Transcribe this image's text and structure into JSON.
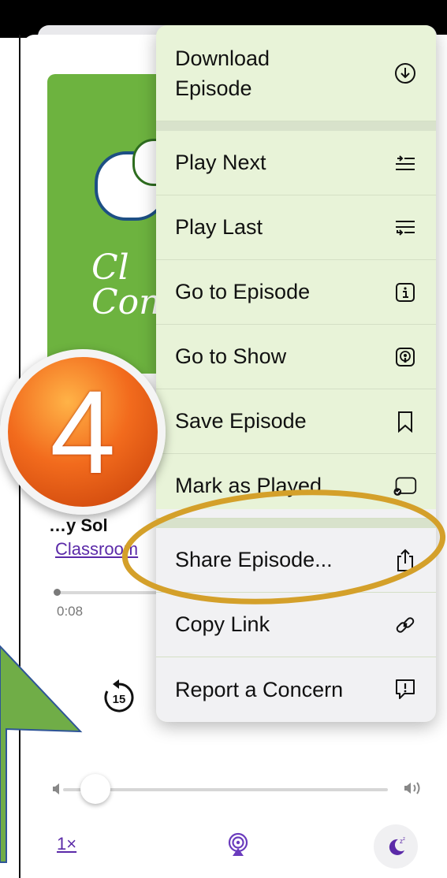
{
  "menu": {
    "items": [
      {
        "label": "Download\nEpisode",
        "icon": "download-circle-icon"
      },
      {
        "label": "Play Next",
        "icon": "play-next-icon"
      },
      {
        "label": "Play Last",
        "icon": "play-last-icon"
      },
      {
        "label": "Go to Episode",
        "icon": "info-icon"
      },
      {
        "label": "Go to Show",
        "icon": "podcast-icon"
      },
      {
        "label": "Save Episode",
        "icon": "bookmark-icon"
      },
      {
        "label": "Mark as Played",
        "icon": "mark-played-icon"
      },
      {
        "label": "Share Episode...",
        "icon": "share-icon"
      },
      {
        "label": "Copy Link",
        "icon": "link-icon"
      },
      {
        "label": "Report a Concern",
        "icon": "report-icon"
      }
    ]
  },
  "player": {
    "artwork_text": "Cl\nCon",
    "title_fragment": "…y Sol",
    "show_link": "Classroom",
    "elapsed": "0:08",
    "skip_back_seconds": "15",
    "playback_rate": "1×",
    "volume_level": 0.08
  },
  "annotation": {
    "step_number": "4",
    "accent_color": "#d4a02a",
    "arrow_color": "#70ad47"
  }
}
